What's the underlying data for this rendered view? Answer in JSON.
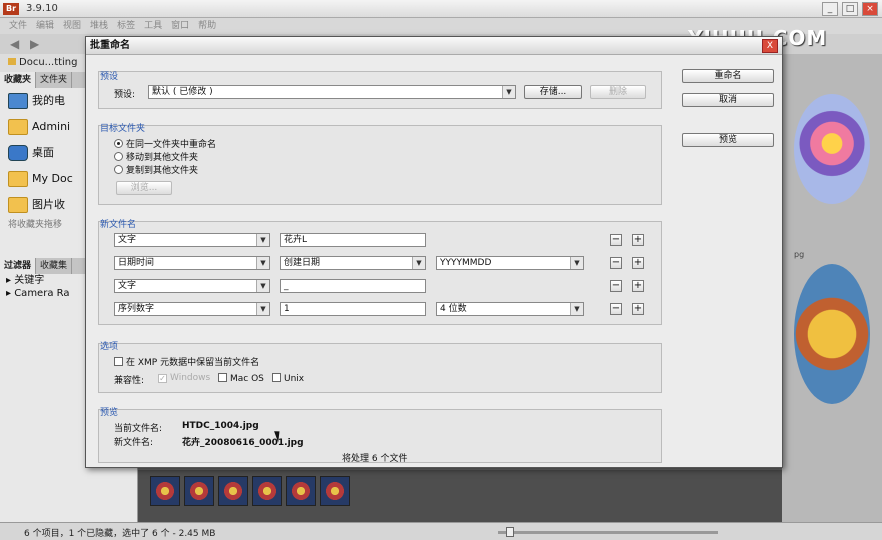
{
  "app": {
    "version": "3.9.10",
    "menu": [
      "文件",
      "编辑",
      "视图",
      "堆栈",
      "标签",
      "工具",
      "窗口",
      "帮助"
    ],
    "path": "Docu...tting",
    "panel_tabs": [
      "收藏夹",
      "文件夹"
    ],
    "favorites": [
      {
        "label": "我的电",
        "icon": "computer-icon"
      },
      {
        "label": "Admini",
        "icon": "folder-icon"
      },
      {
        "label": "桌面",
        "icon": "desktop-icon"
      },
      {
        "label": "My Doc",
        "icon": "folder-icon"
      },
      {
        "label": "图片收",
        "icon": "folder-icon"
      }
    ],
    "fav_hint": "将收藏夹拖移",
    "filter_tabs": [
      "过滤器",
      "收藏集"
    ],
    "filter_rows": [
      "关键字",
      "Camera Ra"
    ],
    "status": "6 个项目，1 个已隐藏，选中了 6 个 - 2.45 MB",
    "thumb_label": "pg",
    "brand": "YIHUU.COM"
  },
  "dialog": {
    "title": "批重命名",
    "close": "X",
    "buttons": {
      "rename": "重命名",
      "cancel": "取消",
      "preview": "预览"
    },
    "preset": {
      "group": "预设",
      "label": "预设:",
      "value": "默认 ( 已修改 )",
      "save": "存储...",
      "delete": "删除"
    },
    "target": {
      "group": "目标文件夹",
      "options": [
        "在同一文件夹中重命名",
        "移动到其他文件夹",
        "复制到其他文件夹"
      ],
      "selected_index": 0,
      "browse": "浏览..."
    },
    "new_name": {
      "group": "新文件名",
      "rows": [
        {
          "type": "文字",
          "value": "花卉L",
          "extra": ""
        },
        {
          "type": "日期时间",
          "value": "创建日期",
          "extra": "YYYYMMDD"
        },
        {
          "type": "文字",
          "value": "_",
          "extra": ""
        },
        {
          "type": "序列数字",
          "value": "1",
          "extra": "4 位数"
        }
      ],
      "minus": "−",
      "plus": "+"
    },
    "options": {
      "group": "选项",
      "keep_xmp": "在 XMP 元数据中保留当前文件名",
      "compat_label": "兼容性:",
      "windows": "Windows",
      "macos": "Mac OS",
      "unix": "Unix"
    },
    "preview": {
      "group": "预览",
      "current_label": "当前文件名:",
      "current_value": "HTDC_1004.jpg",
      "new_label": "新文件名:",
      "new_value": "花卉_20080616_0001.jpg",
      "count": "将处理 6 个文件"
    }
  }
}
